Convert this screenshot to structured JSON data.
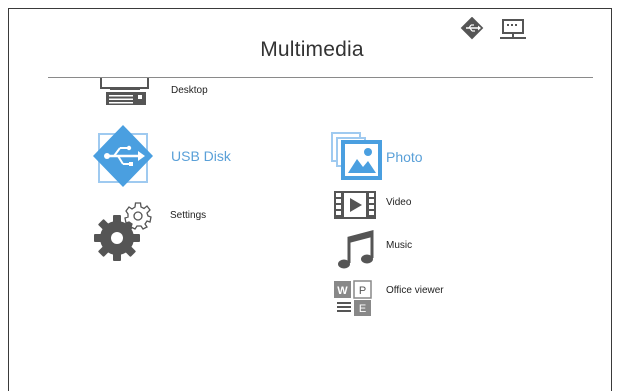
{
  "header": {
    "title": "Multimedia",
    "status_icons": [
      "usb-status-icon",
      "network-status-icon"
    ]
  },
  "menu": {
    "desktop": {
      "label": "Desktop",
      "icon": "desktop-icon"
    },
    "usb_disk": {
      "label": "USB Disk",
      "icon": "usb-icon",
      "selected": true
    },
    "settings": {
      "label": "Settings",
      "icon": "gears-icon"
    },
    "photo": {
      "label": "Photo",
      "icon": "photo-icon",
      "selected": true
    },
    "video": {
      "label": "Video",
      "icon": "video-icon"
    },
    "music": {
      "label": "Music",
      "icon": "music-note-icon"
    },
    "office_viewer": {
      "label": "Office viewer",
      "icon": "office-docs-icon"
    }
  },
  "colors": {
    "accent": "#4a9fe0",
    "selected_text": "#5aa0d8",
    "icon_gray": "#555555",
    "frame": "#3a3a3a"
  }
}
